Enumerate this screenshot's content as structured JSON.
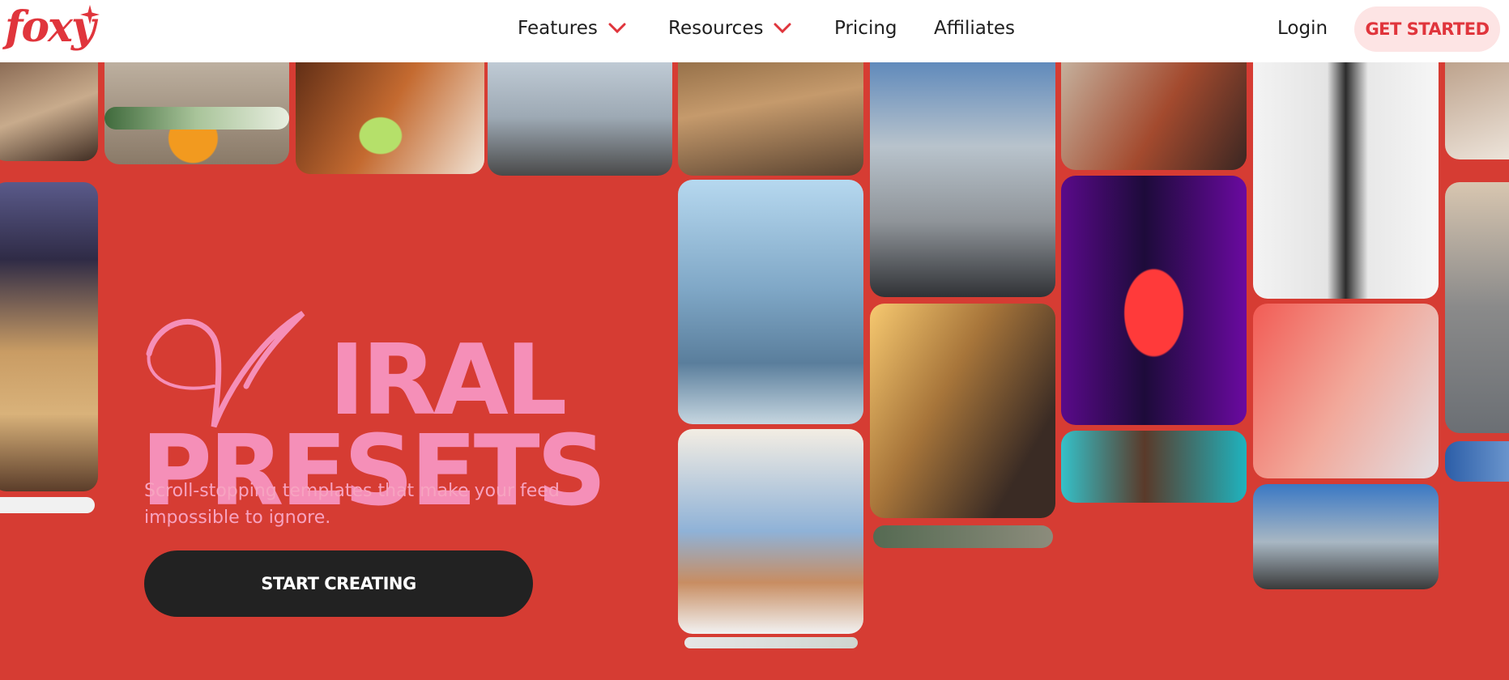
{
  "brand": {
    "logo_text": "foxy",
    "accent": "#e0353c",
    "hero_bg": "#d63c33",
    "title_color": "#f58fb8"
  },
  "nav": {
    "features": "Features",
    "resources": "Resources",
    "pricing": "Pricing",
    "affiliates": "Affiliates",
    "login": "Login",
    "get_started": "GET STARTED"
  },
  "hero": {
    "title_line1": "IRAL",
    "title_line2": "PRESETS",
    "subtitle": "Scroll-stopping templates that make your feed impossible to ignore.",
    "cta": "START CREATING"
  },
  "icons": {
    "dropdown": "chevron-down-icon",
    "logo_mark": "sparkle-icon"
  }
}
